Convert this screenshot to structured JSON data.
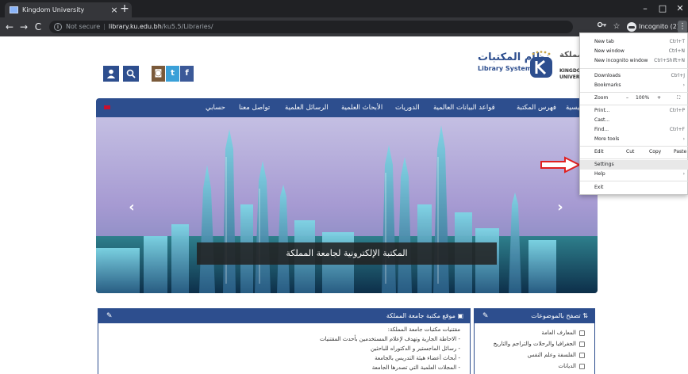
{
  "browser": {
    "tab_title": "Kingdom University",
    "tab_close": "×",
    "new_tab": "+",
    "window_controls": {
      "minimize": "–",
      "maximize": "□",
      "close": "✕"
    },
    "nav": {
      "back": "←",
      "forward": "→",
      "reload": "C"
    },
    "omnibox": {
      "info_icon": "i",
      "security": "Not secure",
      "separator": "|",
      "host": "library.ku.edu.bh",
      "path": "/ku5.5/Libraries/"
    },
    "incognito_label": "Incognito (2)",
    "menu_button": "⋮"
  },
  "chrome_menu": {
    "items": [
      {
        "label": "New tab",
        "shortcut": "Ctrl+T"
      },
      {
        "label": "New window",
        "shortcut": "Ctrl+N"
      },
      {
        "label": "New incognito window",
        "shortcut": "Ctrl+Shift+N"
      },
      {
        "label": "Downloads",
        "shortcut": "Ctrl+J"
      },
      {
        "label": "Bookmarks",
        "shortcut": "›"
      },
      {
        "label": "Zoom",
        "minus": "–",
        "value": "100%",
        "plus": "+",
        "fullscreen": "⛶"
      },
      {
        "label": "Print...",
        "shortcut": "Ctrl+P"
      },
      {
        "label": "Cast...",
        "shortcut": ""
      },
      {
        "label": "Find...",
        "shortcut": "Ctrl+F"
      },
      {
        "label": "More tools",
        "shortcut": "›"
      },
      {
        "label": "Edit",
        "cut": "Cut",
        "copy": "Copy",
        "paste": "Paste"
      },
      {
        "label": "Settings",
        "shortcut": ""
      },
      {
        "label": "Help",
        "shortcut": "›"
      },
      {
        "label": "Exit",
        "shortcut": ""
      }
    ],
    "highlighted": "Settings"
  },
  "header": {
    "user_icon": "👤",
    "search_icon": "🔍",
    "social": {
      "instagram": "◙",
      "twitter": "t",
      "facebook": "f"
    },
    "logo_title_ar": "نظام المكتبات",
    "logo_title_en": "Library System",
    "university_ar": "جامعة المملكة",
    "university_en_1": "KINGDOM",
    "university_en_2": "UNIVERSITY"
  },
  "navbar": {
    "items": [
      "حسابي",
      "تواصل معنا",
      "الرسائل العلمية",
      "الأبحاث العلمية",
      "الدوريات",
      "قواعد البيانات العالمية",
      "فهرس المكتبة",
      "الرئيسية"
    ]
  },
  "slider": {
    "caption": "المكتبة الإلكترونية لجامعة المملكة",
    "prev": "‹",
    "next": "›"
  },
  "box_library": {
    "title": "موقع مكتبة جامعة المملكة",
    "pin": "✎",
    "lines": [
      "مقتنيات مكتبات جامعة المملكة:",
      "- الاحاطة الجارية وتهدف لإعلام المستخدمين بأحدث المقتنيات",
      "- رسائل الماجستير و الدكتوراه للباحثين",
      "- أبحاث أعضاء هيئة التدريس بالجامعة",
      "- المجلات العلمية التي تصدرها الجامعة"
    ]
  },
  "box_topics": {
    "title": "تصفح بالموضوعات",
    "pin": "✎",
    "items": [
      "المعارف العامة",
      "الجغرافيا والرحلات والتراجم والتاريخ",
      "الفلسفة وعلم النفس",
      "الديانات"
    ]
  },
  "colors": {
    "brand_blue": "#2d4e8e",
    "chrome_dark": "#202124",
    "chrome_toolbar": "#35363a",
    "annotation_red": "#e02020"
  }
}
